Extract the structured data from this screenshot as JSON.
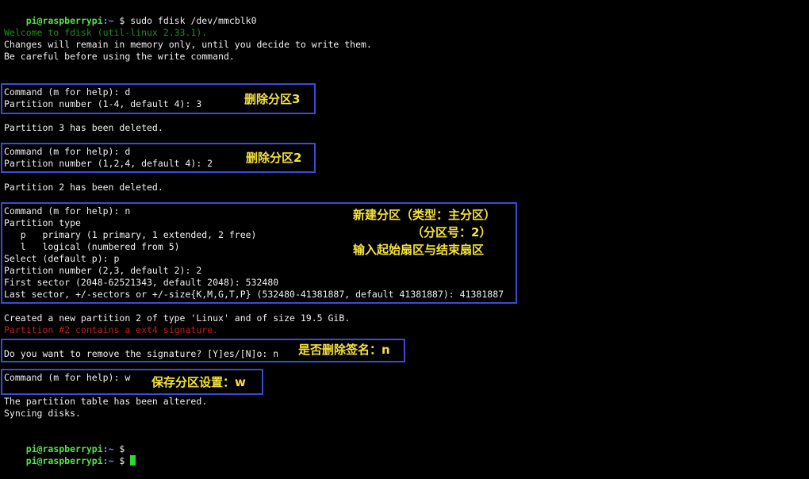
{
  "prompt": {
    "user_host": "pi@raspberrypi",
    "path": ":~",
    "dollar": " $"
  },
  "lines": {
    "l0_cmd": " sudo fdisk /dev/mmcblk0",
    "l1": "Welcome to fdisk (util-linux 2.33.1).",
    "l2": "Changes will remain in memory only, until you decide to write them.",
    "l3": "Be careful before using the write command.",
    "l4": "Command (m for help): d",
    "l5": "Partition number (1-4, default 4): 3",
    "l6": "Partition 3 has been deleted.",
    "l7": "Command (m for help): d",
    "l8": "Partition number (1,2,4, default 4): 2",
    "l9": "Partition 2 has been deleted.",
    "l10": "Command (m for help): n",
    "l11": "Partition type",
    "l12": "   p   primary (1 primary, 1 extended, 2 free)",
    "l13": "   l   logical (numbered from 5)",
    "l14": "Select (default p): p",
    "l15": "Partition number (2,3, default 2): 2",
    "l16": "First sector (2048-62521343, default 2048): 532480",
    "l17": "Last sector, +/-sectors or +/-size{K,M,G,T,P} (532480-41381887, default 41381887): 41381887",
    "l18": "Created a new partition 2 of type 'Linux' and of size 19.5 GiB.",
    "l19": "Partition #2 contains a ext4 signature.",
    "l20": "Do you want to remove the signature? [Y]es/[N]o: n",
    "l21": "Command (m for help): w",
    "l22": "The partition table has been altered.",
    "l23": "Syncing disks."
  },
  "annotations": {
    "a1": "删除分区3",
    "a2": "删除分区2",
    "a3_line1": "新建分区（类型：主分区）",
    "a3_line2": "（分区号：2）",
    "a3_line3": "输入起始扇区与结束扇区",
    "a4": "是否删除签名：n",
    "a5": "保存分区设置：w"
  },
  "colors": {
    "background": "#000000",
    "text": "#f0f0f0",
    "prompt_user": "#54e24a",
    "prompt_path": "#6f8fff",
    "dim_green": "#1e8e1e",
    "warning_red": "#c02020",
    "box_border": "#3b4bd6",
    "annotation_yellow": "#f5e23a",
    "cursor": "#2bdc2b"
  }
}
